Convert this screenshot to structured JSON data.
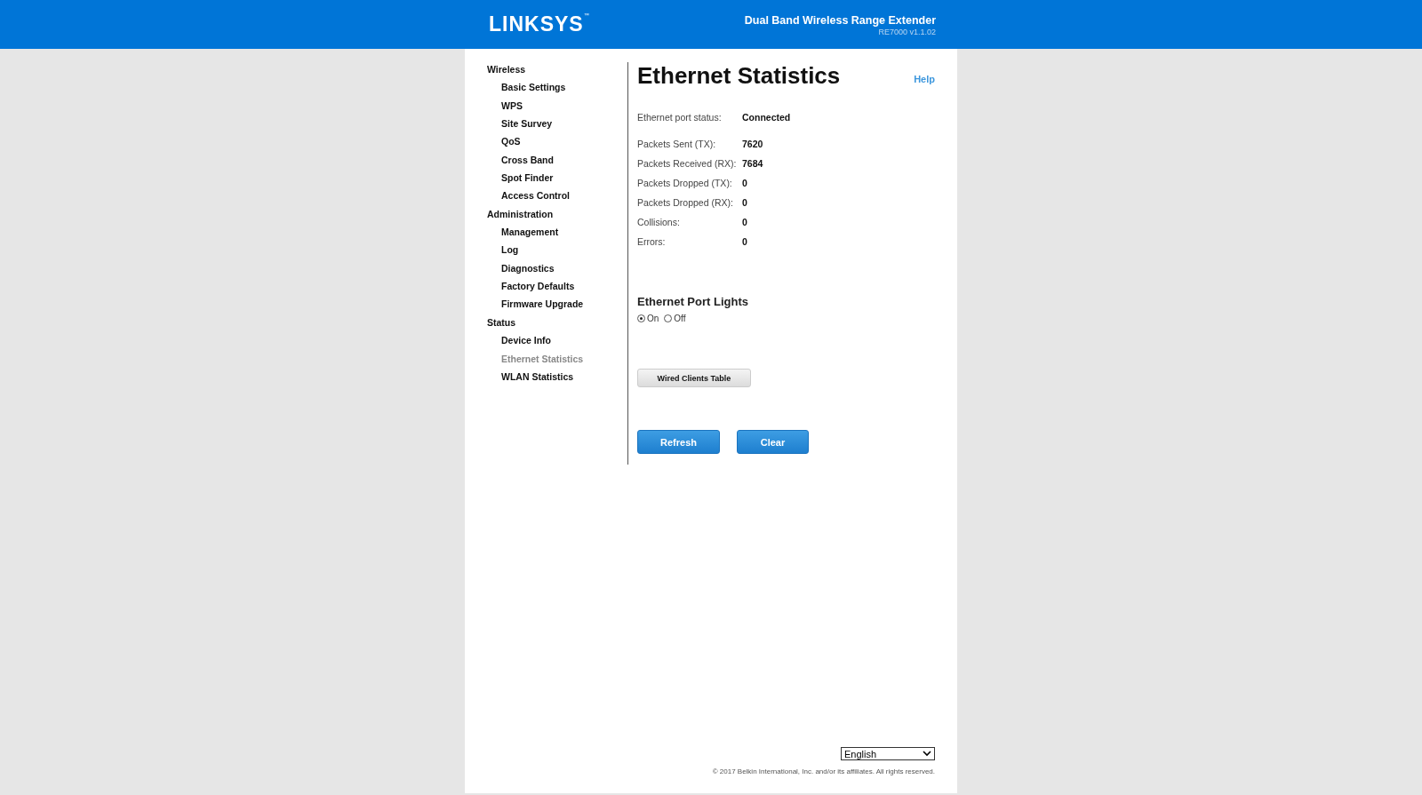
{
  "header": {
    "logo": "LINKSYS",
    "trademark": "™",
    "product": "Dual Band Wireless Range Extender",
    "version": "RE7000 v1.1.02"
  },
  "sidebar": {
    "items": [
      {
        "label": "Wireless",
        "selected": false,
        "children": [
          {
            "label": "Basic Settings",
            "selected": false
          },
          {
            "label": "WPS",
            "selected": false
          },
          {
            "label": "Site Survey",
            "selected": false
          },
          {
            "label": "QoS",
            "selected": false
          },
          {
            "label": "Cross Band",
            "selected": false
          },
          {
            "label": "Spot Finder",
            "selected": false
          },
          {
            "label": "Access Control",
            "selected": false
          }
        ]
      },
      {
        "label": "Administration",
        "selected": false,
        "children": [
          {
            "label": "Management",
            "selected": false
          },
          {
            "label": "Log",
            "selected": false
          },
          {
            "label": "Diagnostics",
            "selected": false
          },
          {
            "label": "Factory Defaults",
            "selected": false
          },
          {
            "label": "Firmware Upgrade",
            "selected": false
          }
        ]
      },
      {
        "label": "Status",
        "selected": false,
        "children": [
          {
            "label": "Device Info",
            "selected": false
          },
          {
            "label": "Ethernet Statistics",
            "selected": true
          },
          {
            "label": "WLAN Statistics",
            "selected": false
          }
        ]
      }
    ]
  },
  "page": {
    "title": "Ethernet Statistics",
    "help": "Help",
    "port_status": {
      "label": "Ethernet port status:",
      "value": "Connected"
    },
    "stats": [
      {
        "label": "Packets Sent (TX):",
        "value": "7620"
      },
      {
        "label": "Packets Received (RX):",
        "value": "7684"
      },
      {
        "label": "Packets Dropped (TX):",
        "value": "0"
      },
      {
        "label": "Packets Dropped (RX):",
        "value": "0"
      },
      {
        "label": "Collisions:",
        "value": "0"
      },
      {
        "label": "Errors:",
        "value": "0"
      }
    ],
    "port_lights": {
      "heading": "Ethernet Port Lights",
      "options": [
        {
          "label": "On",
          "selected": true
        },
        {
          "label": "Off",
          "selected": false
        }
      ]
    },
    "wired_clients_button": "Wired Clients Table",
    "buttons": [
      "Refresh",
      "Clear"
    ]
  },
  "footer": {
    "language": "English",
    "copyright": "© 2017 Belkin International, Inc. and/or its affiliates. All rights reserved."
  }
}
